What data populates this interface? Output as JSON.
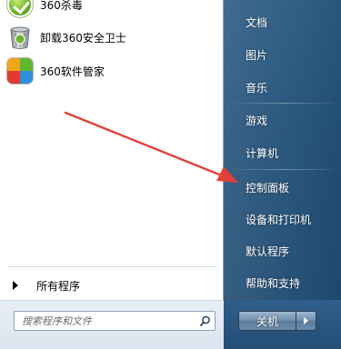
{
  "left_pane": {
    "programs": [
      {
        "label": "360杀毒",
        "icon": "360-antivirus-icon"
      },
      {
        "label": "卸载360安全卫士",
        "icon": "recycle-bin-icon"
      },
      {
        "label": "360软件管家",
        "icon": "360-software-manager-icon"
      }
    ],
    "all_programs_label": "所有程序"
  },
  "search": {
    "placeholder": "搜索程序和文件",
    "icon": "search-icon"
  },
  "right_pane": {
    "items": [
      {
        "label": "文档"
      },
      {
        "label": "图片"
      },
      {
        "label": "音乐"
      },
      {
        "label": "游戏"
      },
      {
        "label": "计算机"
      },
      {
        "label": "控制面板"
      },
      {
        "label": "设备和打印机"
      },
      {
        "label": "默认程序"
      },
      {
        "label": "帮助和支持"
      }
    ]
  },
  "shutdown": {
    "label": "关机",
    "arrow_icon": "chevron-right-icon"
  },
  "annotation": {
    "type": "red-arrow",
    "color": "#e0403a",
    "points_to": "控制面板"
  },
  "colors": {
    "right_pane_bg": "#235079",
    "left_pane_bg": "#ffffff",
    "accent_arrow": "#e0403a"
  }
}
